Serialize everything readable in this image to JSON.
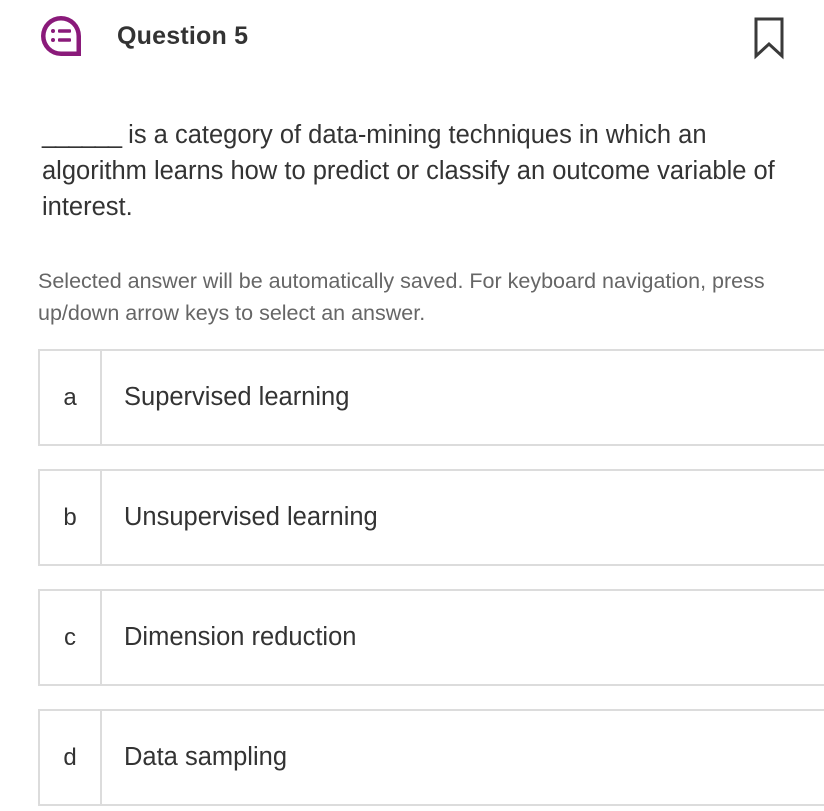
{
  "colors": {
    "accent": "#8a1a7a",
    "text": "#333333",
    "muted": "#666666",
    "border": "#dcdcdc"
  },
  "header": {
    "icon": "question-list-icon",
    "title": "Question 5",
    "bookmark_icon": "bookmark-icon"
  },
  "question": {
    "blank": "______",
    "text": " is a category of data-mining techniques in which an algorithm learns how to predict or classify an outcome variable of interest."
  },
  "instructions": "Selected answer will be automatically saved. For keyboard navigation, press up/down arrow keys to select an answer.",
  "options": [
    {
      "letter": "a",
      "label": "Supervised learning"
    },
    {
      "letter": "b",
      "label": "Unsupervised learning"
    },
    {
      "letter": "c",
      "label": "Dimension reduction"
    },
    {
      "letter": "d",
      "label": "Data sampling"
    }
  ]
}
